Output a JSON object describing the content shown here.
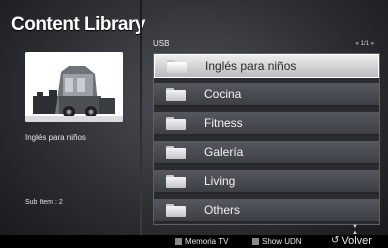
{
  "header": {
    "title": "Content Library"
  },
  "preview": {
    "caption": "Inglés para niños",
    "sub_item": "Sub Item : 2"
  },
  "browser": {
    "breadcrumb": "USB",
    "pager": "« 1/1 »",
    "items": [
      {
        "label": "Inglés para niños",
        "selected": true
      },
      {
        "label": "Cocina"
      },
      {
        "label": "Fitness"
      },
      {
        "label": "Galería"
      },
      {
        "label": "Living"
      },
      {
        "label": "Others"
      }
    ],
    "scroll_arrows": "▼ ▲"
  },
  "footer": {
    "memoria_label": "Memoria TV",
    "udn_label": "Show UDN",
    "back_label": "Volver"
  },
  "colors": {
    "selected_row": "#e0e0e0",
    "row": "#4a4d52",
    "key_square": "#8a8a8a"
  }
}
